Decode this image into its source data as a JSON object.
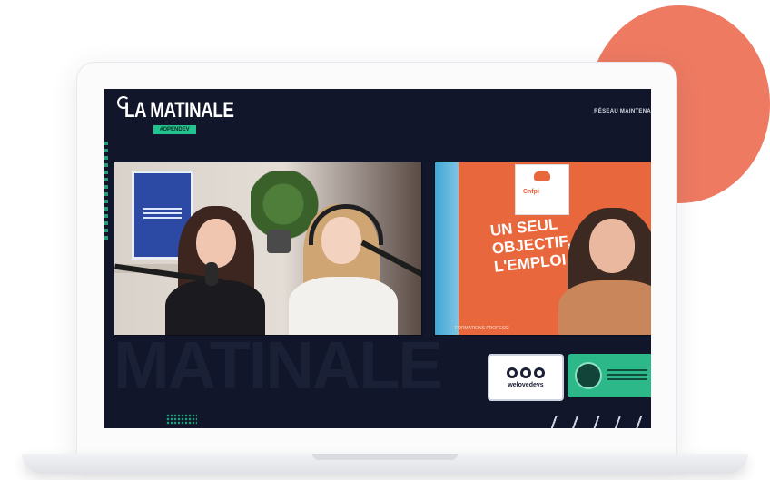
{
  "site": {
    "brand_title": "LA MATINALE",
    "brand_subtitle": "#OPENDEV",
    "nav_label": "RÉSEAU MAINTENA"
  },
  "left_video": {
    "poster_title": "DE RIEN CE N'EST PAS RIEN"
  },
  "right_video": {
    "logo_text": "Cnfpi",
    "slogan": [
      "UN SEUL",
      "OBJECTIF,",
      "L'EMPLOI"
    ],
    "footer_text": "FORMATIONS PROFESSI"
  },
  "sponsors": [
    {
      "name": "welovedevs",
      "label": "welovedevs"
    },
    {
      "name": "sponsor-2",
      "label": ""
    }
  ],
  "colors": {
    "accent_coral": "#ee7a62",
    "screen_bg": "#11162a",
    "brand_green": "#23c28f"
  }
}
